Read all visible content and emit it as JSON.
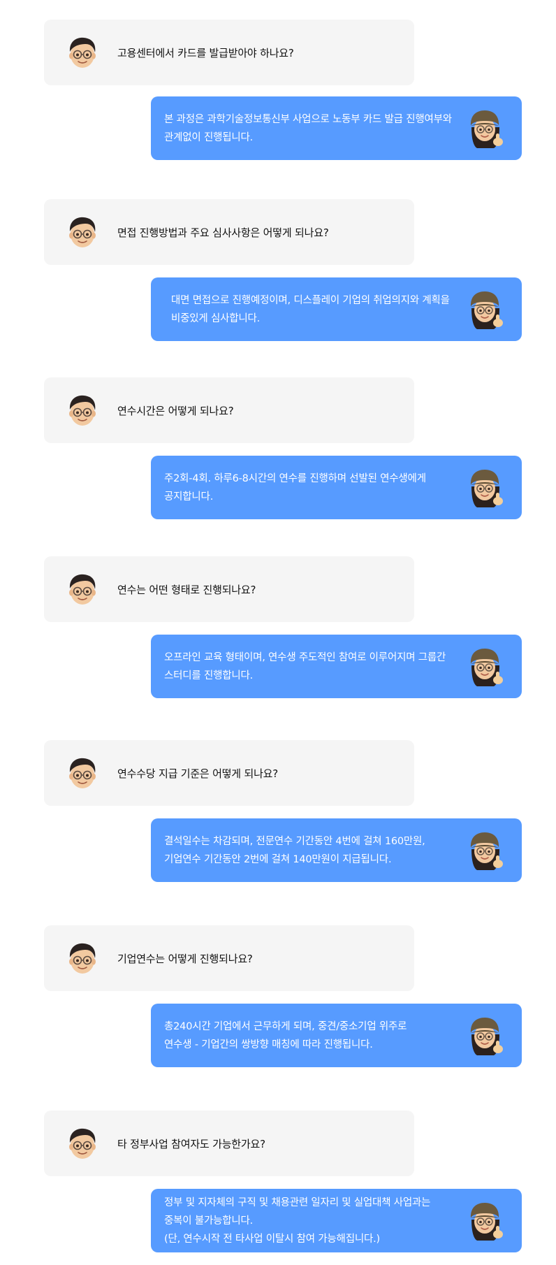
{
  "faq": [
    {
      "question": "고용센터에서 카드를 발급받아야 하나요?",
      "answer": [
        "본 과정은 과학기술정보통신부 사업으로 노동부 카드 발급 진행여부와",
        "관계없이 진행됩니다."
      ]
    },
    {
      "question": "면접 진행방법과 주요 심사사항은 어떻게 되나요?",
      "answer": [
        "대면 면접으로 진행예정이며, 디스플레이 기업의 취업의지와 계획을",
        "비중있게 심사합니다."
      ]
    },
    {
      "question": "연수시간은 어떻게 되나요?",
      "answer": [
        "주2회-4회. 하루6-8시간의 연수를 진행하며 선발된 연수생에게",
        "공지합니다."
      ]
    },
    {
      "question": "연수는 어떤 형태로 진행되나요?",
      "answer": [
        "오프라인 교육 형태이며, 연수생 주도적인 참여로 이루어지며 그룹간",
        "스터디를 진행합니다."
      ]
    },
    {
      "question": "연수수당 지급 기준은 어떻게 되나요?",
      "answer": [
        "결석일수는 차감되며, 전문연수 기간동안 4번에 걸쳐 160만원,",
        "기업연수 기간동안 2번에 걸쳐 140만원이 지급됩니다."
      ]
    },
    {
      "question": "기업연수는 어떻게 진행되나요?",
      "answer": [
        "총240시간 기업에서 근무하게 되며, 중견/중소기업 위주로",
        "연수생 - 기업간의 쌍방향 매칭에 따라 진행됩니다."
      ]
    },
    {
      "question": "타 정부사업 참여자도 가능한가요?",
      "answer": [
        "정부 및 지자체의 구직 및 채용관련 일자리 및 실업대책 사업과는",
        "중복이 불가능합니다.",
        "(단, 연수시작 전 타사업 이탈시 참여 가능해집니다.)"
      ]
    }
  ],
  "icons": {
    "question_avatar": "boy-memoji-icon",
    "answer_avatar": "girl-thumbs-up-memoji-icon"
  },
  "colors": {
    "question_bg": "#f5f5f5",
    "answer_bg": "#579bff",
    "answer_text": "#ffffff",
    "question_text": "#111111"
  }
}
